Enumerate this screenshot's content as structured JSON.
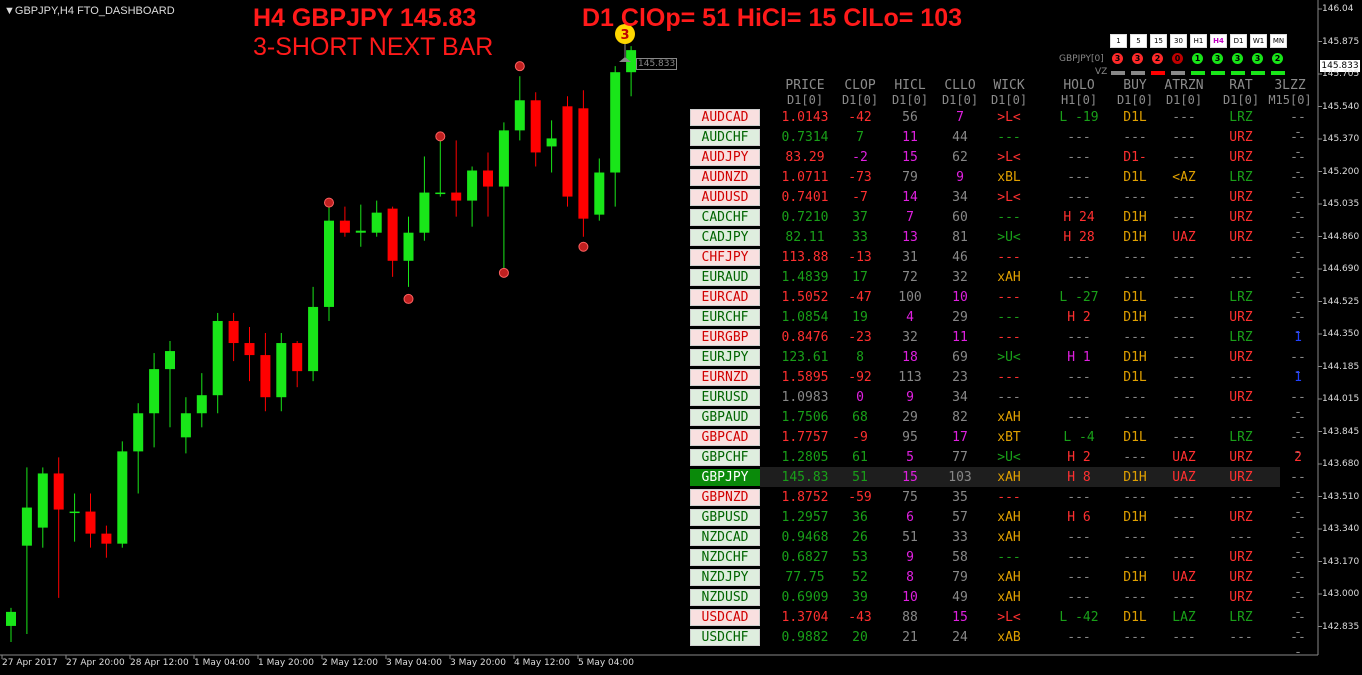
{
  "window_title": "GBPJPY,H4",
  "indicator_name": "FTO_DASHBOARD",
  "header": {
    "line1": "H4 GBPJPY 145.83",
    "line2": "D1 ClOp= 51 HiCl= 15 ClLo= 103",
    "line3": "3-SHORT NEXT BAR"
  },
  "signal_badge": "3",
  "price_tag": "145.833",
  "current_price": "145.833",
  "small_symbol": "GBPJPY[0]",
  "vz_label": "VZ",
  "price_axis": [
    "146.04",
    "145.875",
    "145.705",
    "145.540",
    "145.370",
    "145.200",
    "145.035",
    "144.860",
    "144.690",
    "144.525",
    "144.350",
    "144.185",
    "144.015",
    "143.845",
    "143.680",
    "143.510",
    "143.340",
    "143.170",
    "143.000",
    "142.835"
  ],
  "time_axis": [
    "27 Apr 2017",
    "27 Apr 20:00",
    "28 Apr 12:00",
    "1 May 04:00",
    "1 May 20:00",
    "2 May 12:00",
    "3 May 04:00",
    "3 May 20:00",
    "4 May 12:00",
    "5 May 04:00"
  ],
  "timeframes": [
    {
      "label": "1",
      "active": false
    },
    {
      "label": "5",
      "active": false
    },
    {
      "label": "15",
      "active": false
    },
    {
      "label": "30",
      "active": false
    },
    {
      "label": "H1",
      "active": false
    },
    {
      "label": "H4",
      "active": true
    },
    {
      "label": "D1",
      "active": false
    },
    {
      "label": "W1",
      "active": false
    },
    {
      "label": "MN",
      "active": false
    }
  ],
  "tf_dots": [
    {
      "label": "3",
      "color": "#ff2a2a"
    },
    {
      "label": "3",
      "color": "#ff2a2a"
    },
    {
      "label": "2",
      "color": "#ff2a2a"
    },
    {
      "label": "0",
      "color": "#c00000"
    },
    {
      "label": "1",
      "color": "#19e619"
    },
    {
      "label": "3",
      "color": "#19e619"
    },
    {
      "label": "3",
      "color": "#19e619"
    },
    {
      "label": "3",
      "color": "#19e619"
    },
    {
      "label": "2",
      "color": "#19e619"
    }
  ],
  "vz_dashes": [
    "#888888",
    "#888888",
    "#ff0000",
    "#888888",
    "#19e619",
    "#19e619",
    "#19e619",
    "#19e619",
    "#19e619"
  ],
  "columns": [
    {
      "name": "PRICE",
      "sub": "D1[0]"
    },
    {
      "name": "CLOP",
      "sub": "D1[0]"
    },
    {
      "name": "HICL",
      "sub": "D1[0]"
    },
    {
      "name": "CLLO",
      "sub": "D1[0]"
    },
    {
      "name": "WICK",
      "sub": "D1[0]"
    },
    {
      "name": "HOLO",
      "sub": "H1[0]"
    },
    {
      "name": "BUY",
      "sub": "D1[0]"
    },
    {
      "name": "ATRZN",
      "sub": "D1[0]"
    },
    {
      "name": "RAT",
      "sub": "D1[0]"
    },
    {
      "name": "3LZZ",
      "sub": "M15[0]"
    }
  ],
  "rows": [
    {
      "sym": "AUDCAD",
      "s": "r",
      "price": "1.0143",
      "pc": "#ff3030",
      "clop": "-42",
      "cc": "#ff3030",
      "hicl": "56",
      "hc": "#888",
      "cllo": "7",
      "lc": "#e020e0",
      "wick": ">L<",
      "wc": "#ff3030",
      "holo": "L -19",
      "oc": "#19a019",
      "buy": "D1L",
      "bc": "#e0a000",
      "atr": "---",
      "ac": "#888",
      "rat": "LRZ",
      "rc": "#19a019",
      "lzz": "---",
      "zc": "#888"
    },
    {
      "sym": "AUDCHF",
      "s": "g",
      "price": "0.7314",
      "pc": "#19a019",
      "clop": "7",
      "cc": "#19a019",
      "hicl": "11",
      "hc": "#e020e0",
      "cllo": "44",
      "lc": "#888",
      "wick": "---",
      "wc": "#19a019",
      "holo": "---",
      "oc": "#888",
      "buy": "---",
      "bc": "#888",
      "atr": "---",
      "ac": "#888",
      "rat": "URZ",
      "rc": "#ff3030",
      "lzz": "---",
      "zc": "#888"
    },
    {
      "sym": "AUDJPY",
      "s": "r",
      "price": "83.29",
      "pc": "#ff3030",
      "clop": "-2",
      "cc": "#e020e0",
      "hicl": "15",
      "hc": "#e020e0",
      "cllo": "62",
      "lc": "#888",
      "wick": ">L<",
      "wc": "#ff3030",
      "holo": "---",
      "oc": "#888",
      "buy": "D1-",
      "bc": "#ff3030",
      "atr": "---",
      "ac": "#888",
      "rat": "URZ",
      "rc": "#ff3030",
      "lzz": "---",
      "zc": "#888"
    },
    {
      "sym": "AUDNZD",
      "s": "r",
      "price": "1.0711",
      "pc": "#ff3030",
      "clop": "-73",
      "cc": "#ff3030",
      "hicl": "79",
      "hc": "#888",
      "cllo": "9",
      "lc": "#e020e0",
      "wick": "xBL",
      "wc": "#e0a000",
      "holo": "---",
      "oc": "#888",
      "buy": "D1L",
      "bc": "#e0a000",
      "atr": "<AZ",
      "ac": "#e0a000",
      "rat": "LRZ",
      "rc": "#19a019",
      "lzz": "---",
      "zc": "#888"
    },
    {
      "sym": "AUDUSD",
      "s": "r",
      "price": "0.7401",
      "pc": "#ff3030",
      "clop": "-7",
      "cc": "#ff3030",
      "hicl": "14",
      "hc": "#e020e0",
      "cllo": "34",
      "lc": "#888",
      "wick": ">L<",
      "wc": "#ff3030",
      "holo": "---",
      "oc": "#888",
      "buy": "---",
      "bc": "#888",
      "atr": "---",
      "ac": "#888",
      "rat": "URZ",
      "rc": "#ff3030",
      "lzz": "---",
      "zc": "#888"
    },
    {
      "sym": "CADCHF",
      "s": "g",
      "price": "0.7210",
      "pc": "#19a019",
      "clop": "37",
      "cc": "#19a019",
      "hicl": "7",
      "hc": "#e020e0",
      "cllo": "60",
      "lc": "#888",
      "wick": "---",
      "wc": "#19a019",
      "holo": "H 24",
      "oc": "#ff3030",
      "buy": "D1H",
      "bc": "#e0a000",
      "atr": "---",
      "ac": "#888",
      "rat": "URZ",
      "rc": "#ff3030",
      "lzz": "---",
      "zc": "#888"
    },
    {
      "sym": "CADJPY",
      "s": "g",
      "price": "82.11",
      "pc": "#19a019",
      "clop": "33",
      "cc": "#19a019",
      "hicl": "13",
      "hc": "#e020e0",
      "cllo": "81",
      "lc": "#888",
      "wick": ">U<",
      "wc": "#19a019",
      "holo": "H 28",
      "oc": "#ff3030",
      "buy": "D1H",
      "bc": "#e0a000",
      "atr": "UAZ",
      "ac": "#ff3030",
      "rat": "URZ",
      "rc": "#ff3030",
      "lzz": "---",
      "zc": "#888"
    },
    {
      "sym": "CHFJPY",
      "s": "r",
      "price": "113.88",
      "pc": "#ff3030",
      "clop": "-13",
      "cc": "#ff3030",
      "hicl": "31",
      "hc": "#888",
      "cllo": "46",
      "lc": "#888",
      "wick": "---",
      "wc": "#ff3030",
      "holo": "---",
      "oc": "#888",
      "buy": "---",
      "bc": "#888",
      "atr": "---",
      "ac": "#888",
      "rat": "---",
      "rc": "#888",
      "lzz": "---",
      "zc": "#888"
    },
    {
      "sym": "EURAUD",
      "s": "g",
      "price": "1.4839",
      "pc": "#19a019",
      "clop": "17",
      "cc": "#19a019",
      "hicl": "72",
      "hc": "#888",
      "cllo": "32",
      "lc": "#888",
      "wick": "xAH",
      "wc": "#e0a000",
      "holo": "---",
      "oc": "#888",
      "buy": "---",
      "bc": "#888",
      "atr": "---",
      "ac": "#888",
      "rat": "---",
      "rc": "#888",
      "lzz": "---",
      "zc": "#888"
    },
    {
      "sym": "EURCAD",
      "s": "r",
      "price": "1.5052",
      "pc": "#ff3030",
      "clop": "-47",
      "cc": "#ff3030",
      "hicl": "100",
      "hc": "#888",
      "cllo": "10",
      "lc": "#e020e0",
      "wick": "---",
      "wc": "#ff3030",
      "holo": "L -27",
      "oc": "#19a019",
      "buy": "D1L",
      "bc": "#e0a000",
      "atr": "---",
      "ac": "#888",
      "rat": "LRZ",
      "rc": "#19a019",
      "lzz": "---",
      "zc": "#888"
    },
    {
      "sym": "EURCHF",
      "s": "g",
      "price": "1.0854",
      "pc": "#19a019",
      "clop": "19",
      "cc": "#19a019",
      "hicl": "4",
      "hc": "#e020e0",
      "cllo": "29",
      "lc": "#888",
      "wick": "---",
      "wc": "#19a019",
      "holo": "H 2",
      "oc": "#ff3030",
      "buy": "D1H",
      "bc": "#e0a000",
      "atr": "---",
      "ac": "#888",
      "rat": "URZ",
      "rc": "#ff3030",
      "lzz": "---",
      "zc": "#888"
    },
    {
      "sym": "EURGBP",
      "s": "r",
      "price": "0.8476",
      "pc": "#ff3030",
      "clop": "-23",
      "cc": "#ff3030",
      "hicl": "32",
      "hc": "#888",
      "cllo": "11",
      "lc": "#e020e0",
      "wick": "---",
      "wc": "#ff3030",
      "holo": "---",
      "oc": "#888",
      "buy": "---",
      "bc": "#888",
      "atr": "---",
      "ac": "#888",
      "rat": "LRZ",
      "rc": "#19a019",
      "lzz": "1",
      "zc": "#2040ff"
    },
    {
      "sym": "EURJPY",
      "s": "g",
      "price": "123.61",
      "pc": "#19a019",
      "clop": "8",
      "cc": "#19a019",
      "hicl": "18",
      "hc": "#e020e0",
      "cllo": "69",
      "lc": "#888",
      "wick": ">U<",
      "wc": "#19a019",
      "holo": "H 1",
      "oc": "#e020e0",
      "buy": "D1H",
      "bc": "#e0a000",
      "atr": "---",
      "ac": "#888",
      "rat": "URZ",
      "rc": "#ff3030",
      "lzz": "---",
      "zc": "#888"
    },
    {
      "sym": "EURNZD",
      "s": "r",
      "price": "1.5895",
      "pc": "#ff3030",
      "clop": "-92",
      "cc": "#ff3030",
      "hicl": "113",
      "hc": "#888",
      "cllo": "23",
      "lc": "#888",
      "wick": "---",
      "wc": "#ff3030",
      "holo": "---",
      "oc": "#888",
      "buy": "D1L",
      "bc": "#e0a000",
      "atr": "---",
      "ac": "#888",
      "rat": "---",
      "rc": "#888",
      "lzz": "1",
      "zc": "#2040ff"
    },
    {
      "sym": "EURUSD",
      "s": "g",
      "price": "1.0983",
      "pc": "#888",
      "clop": "0",
      "cc": "#e020e0",
      "hicl": "9",
      "hc": "#e020e0",
      "cllo": "34",
      "lc": "#888",
      "wick": "---",
      "wc": "#888",
      "holo": "---",
      "oc": "#888",
      "buy": "---",
      "bc": "#888",
      "atr": "---",
      "ac": "#888",
      "rat": "URZ",
      "rc": "#ff3030",
      "lzz": "---",
      "zc": "#888"
    },
    {
      "sym": "GBPAUD",
      "s": "g",
      "price": "1.7506",
      "pc": "#19a019",
      "clop": "68",
      "cc": "#19a019",
      "hicl": "29",
      "hc": "#888",
      "cllo": "82",
      "lc": "#888",
      "wick": "xAH",
      "wc": "#e0a000",
      "holo": "---",
      "oc": "#888",
      "buy": "---",
      "bc": "#888",
      "atr": "---",
      "ac": "#888",
      "rat": "---",
      "rc": "#888",
      "lzz": "---",
      "zc": "#888"
    },
    {
      "sym": "GBPCAD",
      "s": "r",
      "price": "1.7757",
      "pc": "#ff3030",
      "clop": "-9",
      "cc": "#ff3030",
      "hicl": "95",
      "hc": "#888",
      "cllo": "17",
      "lc": "#e020e0",
      "wick": "xBT",
      "wc": "#e0a000",
      "holo": "L -4",
      "oc": "#19a019",
      "buy": "D1L",
      "bc": "#e0a000",
      "atr": "---",
      "ac": "#888",
      "rat": "LRZ",
      "rc": "#19a019",
      "lzz": "---",
      "zc": "#888"
    },
    {
      "sym": "GBPCHF",
      "s": "g",
      "price": "1.2805",
      "pc": "#19a019",
      "clop": "61",
      "cc": "#19a019",
      "hicl": "5",
      "hc": "#e020e0",
      "cllo": "77",
      "lc": "#888",
      "wick": ">U<",
      "wc": "#19a019",
      "holo": "H 2",
      "oc": "#ff3030",
      "buy": "---",
      "bc": "#888",
      "atr": "UAZ",
      "ac": "#ff3030",
      "rat": "URZ",
      "rc": "#ff3030",
      "lzz": "2",
      "zc": "#ff3030"
    },
    {
      "sym": "GBPJPY",
      "s": "sel",
      "price": "145.83",
      "pc": "#19a019",
      "clop": "51",
      "cc": "#19a019",
      "hicl": "15",
      "hc": "#e020e0",
      "cllo": "103",
      "lc": "#888",
      "wick": "xAH",
      "wc": "#e0a000",
      "holo": "H 8",
      "oc": "#ff3030",
      "buy": "D1H",
      "bc": "#e0a000",
      "atr": "UAZ",
      "ac": "#ff3030",
      "rat": "URZ",
      "rc": "#ff3030",
      "lzz": "---",
      "zc": "#888"
    },
    {
      "sym": "GBPNZD",
      "s": "r",
      "price": "1.8752",
      "pc": "#ff3030",
      "clop": "-59",
      "cc": "#ff3030",
      "hicl": "75",
      "hc": "#888",
      "cllo": "35",
      "lc": "#888",
      "wick": "---",
      "wc": "#ff3030",
      "holo": "---",
      "oc": "#888",
      "buy": "---",
      "bc": "#888",
      "atr": "---",
      "ac": "#888",
      "rat": "---",
      "rc": "#888",
      "lzz": "---",
      "zc": "#888"
    },
    {
      "sym": "GBPUSD",
      "s": "g",
      "price": "1.2957",
      "pc": "#19a019",
      "clop": "36",
      "cc": "#19a019",
      "hicl": "6",
      "hc": "#e020e0",
      "cllo": "57",
      "lc": "#888",
      "wick": "xAH",
      "wc": "#e0a000",
      "holo": "H 6",
      "oc": "#ff3030",
      "buy": "D1H",
      "bc": "#e0a000",
      "atr": "---",
      "ac": "#888",
      "rat": "URZ",
      "rc": "#ff3030",
      "lzz": "---",
      "zc": "#888"
    },
    {
      "sym": "NZDCAD",
      "s": "g",
      "price": "0.9468",
      "pc": "#19a019",
      "clop": "26",
      "cc": "#19a019",
      "hicl": "51",
      "hc": "#888",
      "cllo": "33",
      "lc": "#888",
      "wick": "xAH",
      "wc": "#e0a000",
      "holo": "---",
      "oc": "#888",
      "buy": "---",
      "bc": "#888",
      "atr": "---",
      "ac": "#888",
      "rat": "---",
      "rc": "#888",
      "lzz": "---",
      "zc": "#888"
    },
    {
      "sym": "NZDCHF",
      "s": "g",
      "price": "0.6827",
      "pc": "#19a019",
      "clop": "53",
      "cc": "#19a019",
      "hicl": "9",
      "hc": "#e020e0",
      "cllo": "58",
      "lc": "#888",
      "wick": "---",
      "wc": "#19a019",
      "holo": "---",
      "oc": "#888",
      "buy": "---",
      "bc": "#888",
      "atr": "---",
      "ac": "#888",
      "rat": "URZ",
      "rc": "#ff3030",
      "lzz": "---",
      "zc": "#888"
    },
    {
      "sym": "NZDJPY",
      "s": "g",
      "price": "77.75",
      "pc": "#19a019",
      "clop": "52",
      "cc": "#19a019",
      "hicl": "8",
      "hc": "#e020e0",
      "cllo": "79",
      "lc": "#888",
      "wick": "xAH",
      "wc": "#e0a000",
      "holo": "---",
      "oc": "#888",
      "buy": "D1H",
      "bc": "#e0a000",
      "atr": "UAZ",
      "ac": "#ff3030",
      "rat": "URZ",
      "rc": "#ff3030",
      "lzz": "---",
      "zc": "#888"
    },
    {
      "sym": "NZDUSD",
      "s": "g",
      "price": "0.6909",
      "pc": "#19a019",
      "clop": "39",
      "cc": "#19a019",
      "hicl": "10",
      "hc": "#e020e0",
      "cllo": "49",
      "lc": "#888",
      "wick": "xAH",
      "wc": "#e0a000",
      "holo": "---",
      "oc": "#888",
      "buy": "---",
      "bc": "#888",
      "atr": "---",
      "ac": "#888",
      "rat": "URZ",
      "rc": "#ff3030",
      "lzz": "---",
      "zc": "#888"
    },
    {
      "sym": "USDCAD",
      "s": "r",
      "price": "1.3704",
      "pc": "#ff3030",
      "clop": "-43",
      "cc": "#ff3030",
      "hicl": "88",
      "hc": "#888",
      "cllo": "15",
      "lc": "#e020e0",
      "wick": ">L<",
      "wc": "#ff3030",
      "holo": "L -42",
      "oc": "#19a019",
      "buy": "D1L",
      "bc": "#e0a000",
      "atr": "LAZ",
      "ac": "#19a019",
      "rat": "LRZ",
      "rc": "#19a019",
      "lzz": "---",
      "zc": "#888"
    },
    {
      "sym": "USDCHF",
      "s": "g",
      "price": "0.9882",
      "pc": "#19a019",
      "clop": "20",
      "cc": "#19a019",
      "hicl": "21",
      "hc": "#888",
      "cllo": "24",
      "lc": "#888",
      "wick": "xAB",
      "wc": "#e0a000",
      "holo": "---",
      "oc": "#888",
      "buy": "---",
      "bc": "#888",
      "atr": "---",
      "ac": "#888",
      "rat": "---",
      "rc": "#888",
      "lzz": "---",
      "zc": "#888"
    }
  ],
  "colors": {
    "bull": "#19e619",
    "bear": "#ff0000",
    "bg": "#000000",
    "alert": "#ff1a1a"
  },
  "candles": [
    {
      "o": 142.96,
      "h": 143.05,
      "l": 142.88,
      "c": 143.03
    },
    {
      "o": 143.36,
      "h": 143.75,
      "l": 142.92,
      "c": 143.55
    },
    {
      "o": 143.45,
      "h": 143.75,
      "l": 143.35,
      "c": 143.72
    },
    {
      "o": 143.72,
      "h": 143.8,
      "l": 143.1,
      "c": 143.54
    },
    {
      "o": 143.53,
      "h": 143.62,
      "l": 143.38,
      "c": 143.53
    },
    {
      "o": 143.53,
      "h": 143.62,
      "l": 143.35,
      "c": 143.42
    },
    {
      "o": 143.42,
      "h": 143.46,
      "l": 143.3,
      "c": 143.37
    },
    {
      "o": 143.37,
      "h": 143.88,
      "l": 143.35,
      "c": 143.83
    },
    {
      "o": 143.83,
      "h": 144.07,
      "l": 143.62,
      "c": 144.02
    },
    {
      "o": 144.02,
      "h": 144.32,
      "l": 143.85,
      "c": 144.24
    },
    {
      "o": 144.24,
      "h": 144.38,
      "l": 143.95,
      "c": 144.33
    },
    {
      "o": 143.9,
      "h": 144.1,
      "l": 143.82,
      "c": 144.02
    },
    {
      "o": 144.02,
      "h": 144.22,
      "l": 143.95,
      "c": 144.11
    },
    {
      "o": 144.11,
      "h": 144.52,
      "l": 144.02,
      "c": 144.48
    },
    {
      "o": 144.48,
      "h": 144.52,
      "l": 144.28,
      "c": 144.37
    },
    {
      "o": 144.37,
      "h": 144.45,
      "l": 144.18,
      "c": 144.31
    },
    {
      "o": 144.31,
      "h": 144.42,
      "l": 144.03,
      "c": 144.1
    },
    {
      "o": 144.1,
      "h": 144.42,
      "l": 144.03,
      "c": 144.37
    },
    {
      "o": 144.37,
      "h": 144.38,
      "l": 144.15,
      "c": 144.23
    },
    {
      "o": 144.23,
      "h": 144.65,
      "l": 144.18,
      "c": 144.55
    },
    {
      "o": 144.55,
      "h": 145.06,
      "l": 144.48,
      "c": 144.98
    },
    {
      "o": 144.98,
      "h": 145.05,
      "l": 144.9,
      "c": 144.92
    },
    {
      "o": 144.92,
      "h": 145.06,
      "l": 144.85,
      "c": 144.93
    },
    {
      "o": 144.92,
      "h": 145.08,
      "l": 144.9,
      "c": 145.02
    },
    {
      "o": 145.04,
      "h": 145.05,
      "l": 144.7,
      "c": 144.78
    },
    {
      "o": 144.78,
      "h": 145.0,
      "l": 144.65,
      "c": 144.92
    },
    {
      "o": 144.92,
      "h": 145.3,
      "l": 144.88,
      "c": 145.12
    },
    {
      "o": 145.12,
      "h": 145.4,
      "l": 145.1,
      "c": 145.12
    },
    {
      "o": 145.12,
      "h": 145.38,
      "l": 145.0,
      "c": 145.08
    },
    {
      "o": 145.08,
      "h": 145.25,
      "l": 144.95,
      "c": 145.23
    },
    {
      "o": 145.23,
      "h": 145.32,
      "l": 145.0,
      "c": 145.15
    },
    {
      "o": 145.15,
      "h": 145.47,
      "l": 144.72,
      "c": 145.43
    },
    {
      "o": 145.43,
      "h": 145.7,
      "l": 145.38,
      "c": 145.58
    },
    {
      "o": 145.58,
      "h": 145.62,
      "l": 145.25,
      "c": 145.32
    },
    {
      "o": 145.35,
      "h": 145.48,
      "l": 145.22,
      "c": 145.39
    },
    {
      "o": 145.55,
      "h": 145.6,
      "l": 145.05,
      "c": 145.1
    },
    {
      "o": 145.54,
      "h": 145.63,
      "l": 144.9,
      "c": 144.99
    },
    {
      "o": 145.01,
      "h": 145.29,
      "l": 144.98,
      "c": 145.22
    },
    {
      "o": 145.22,
      "h": 145.75,
      "l": 145.05,
      "c": 145.72
    },
    {
      "o": 145.72,
      "h": 145.85,
      "l": 145.6,
      "c": 145.83
    }
  ],
  "markers": [
    {
      "i": 20,
      "p": 145.07
    },
    {
      "i": 25,
      "p": 144.59
    },
    {
      "i": 27,
      "p": 145.4
    },
    {
      "i": 31,
      "p": 144.72
    },
    {
      "i": 32,
      "p": 145.75
    },
    {
      "i": 36,
      "p": 144.85
    }
  ]
}
